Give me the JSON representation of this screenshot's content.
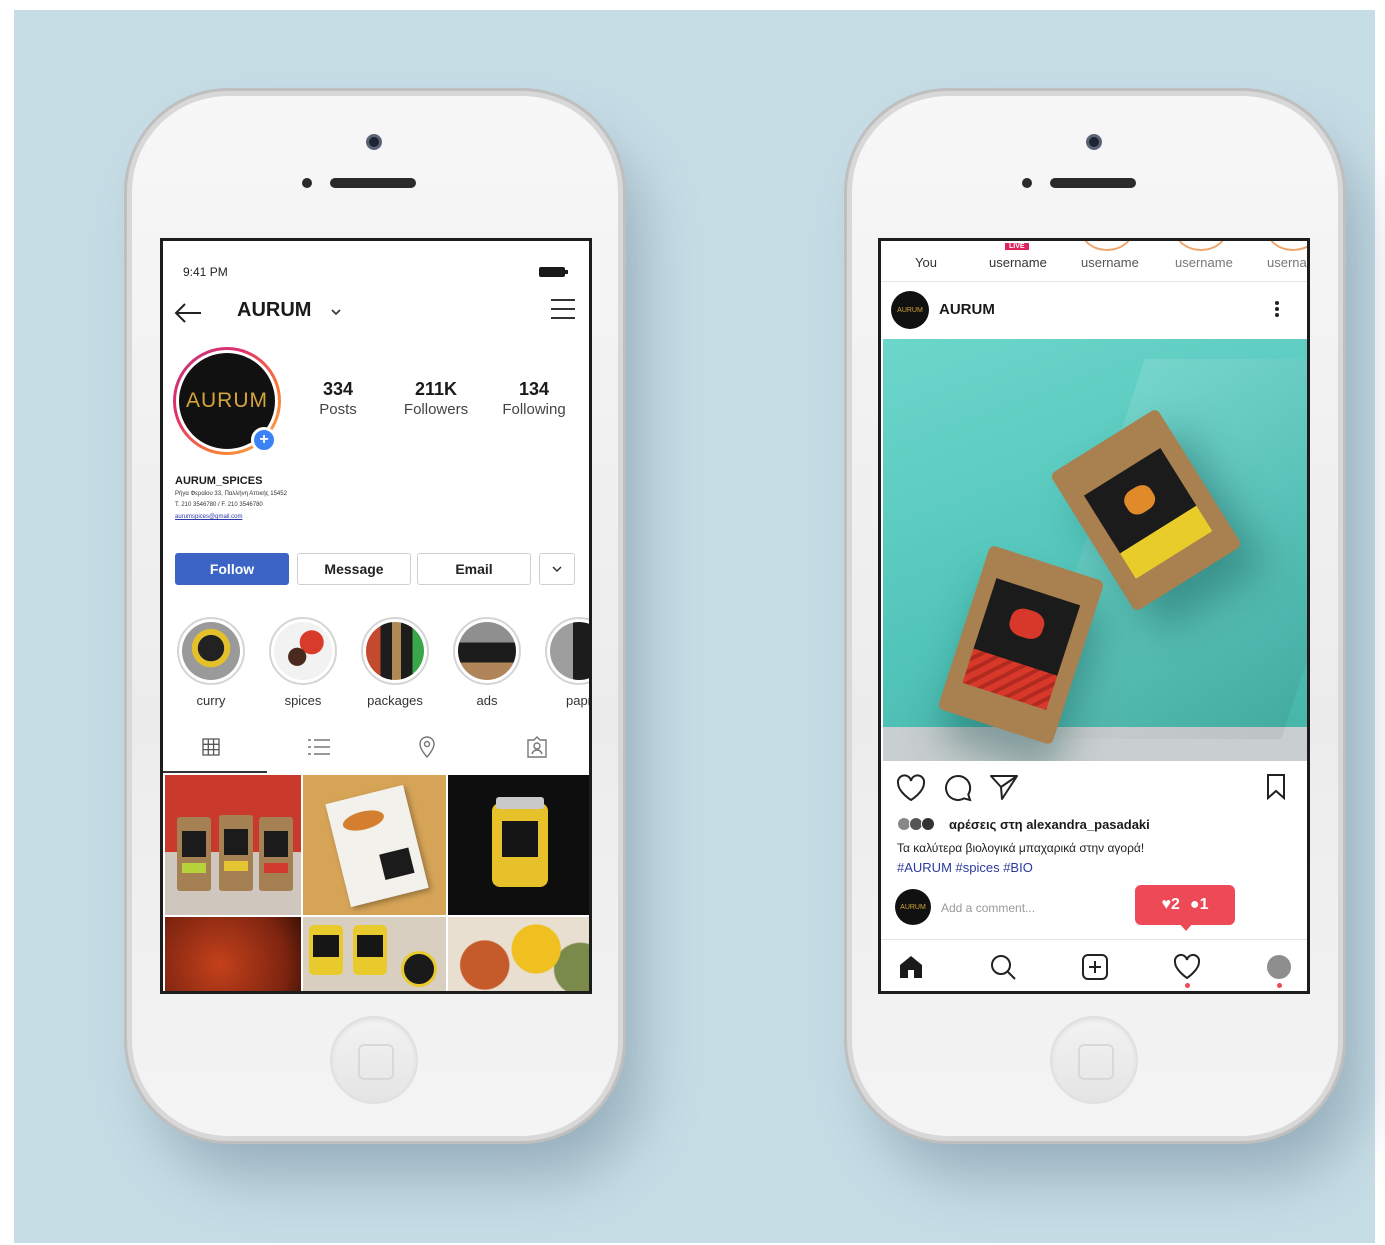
{
  "profile_screen": {
    "status_time": "9:41 PM",
    "username": "AURUM",
    "avatar_text": "AURUM",
    "stats": [
      {
        "value": "334",
        "label": "Posts"
      },
      {
        "value": "211K",
        "label": "Followers"
      },
      {
        "value": "134",
        "label": "Following"
      }
    ],
    "bio": {
      "name": "AURUM_SPICES",
      "address": "Ρήγα Φεραίου 33, Παλλήνη Αττικής 15452",
      "phone": "T. 210 3546780 / F. 210 3546780",
      "email": "aurumspices@gmail.com"
    },
    "buttons": {
      "follow": "Follow",
      "message": "Message",
      "email": "Email"
    },
    "highlights": [
      "curry",
      "spices",
      "packages",
      "ads",
      "papr"
    ]
  },
  "feed_screen": {
    "stories": [
      "You",
      "username",
      "username",
      "username",
      "userna"
    ],
    "live_badge": "LIVE",
    "post_author": "AURUM",
    "liked_by": "αρέσεις στη alexandra_pasadaki",
    "caption": "Τα καλύτερα βιολογικά μπαχαρικά στην αγορά!",
    "hashtags": "#AURUM #spices #BIO",
    "comment_placeholder": "Add a comment...",
    "notification": {
      "likes": "2",
      "comments": "1"
    }
  },
  "colors": {
    "background": "#c7dde6",
    "follow_button": "#3b64c4",
    "notification": "#ed4956",
    "post_background": "#5cc9bf"
  },
  "icons": [
    "back-arrow-icon",
    "chevron-down-icon",
    "menu-icon",
    "add-icon",
    "grid-icon",
    "list-icon",
    "location-icon",
    "tagged-icon",
    "heart-icon",
    "comment-icon",
    "share-icon",
    "bookmark-icon",
    "more-icon",
    "home-icon",
    "search-icon",
    "new-post-icon",
    "activity-icon",
    "profile-icon"
  ]
}
